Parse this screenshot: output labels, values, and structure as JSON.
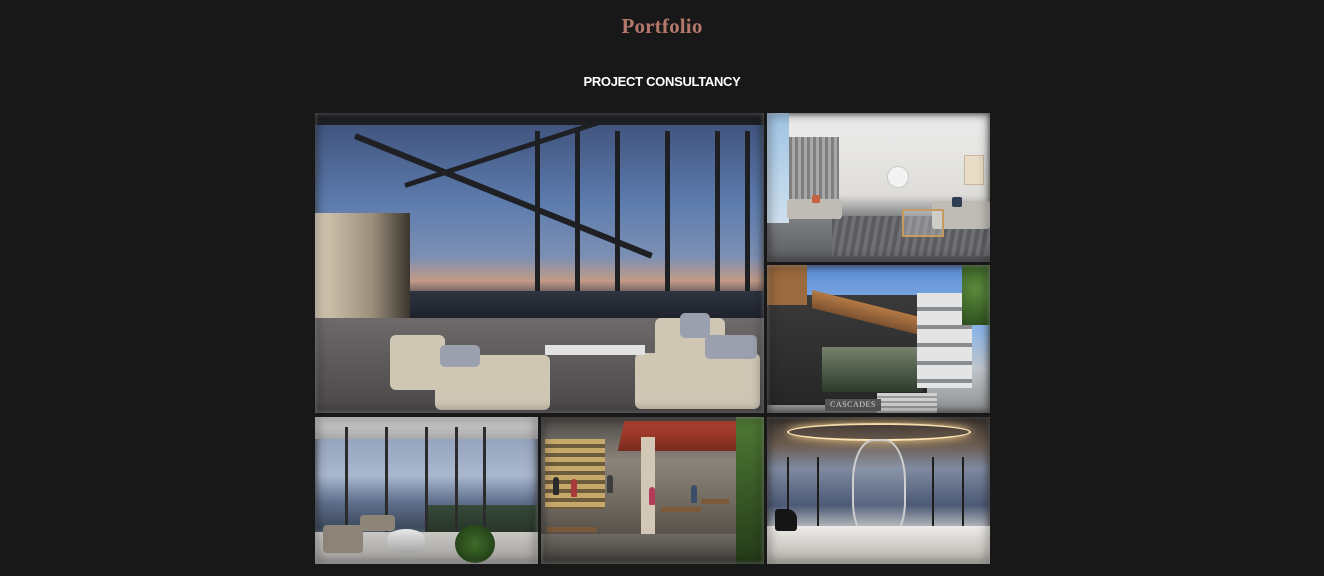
{
  "header": {
    "title": "Portfolio",
    "subtitle": "PROJECT CONSULTANCY"
  },
  "gallery": {
    "images": [
      {
        "name": "rooftop-terrace-image",
        "sign_text": ""
      },
      {
        "name": "living-room-image",
        "sign_text": ""
      },
      {
        "name": "building-facade-image",
        "sign_text": "CASCADES"
      },
      {
        "name": "penthouse-lounge-image",
        "sign_text": ""
      },
      {
        "name": "cafe-dining-image",
        "sign_text": ""
      },
      {
        "name": "grand-foyer-image",
        "sign_text": ""
      }
    ]
  },
  "colors": {
    "background": "#181818",
    "title": "#b3786a",
    "subtitle": "#ffffff"
  }
}
